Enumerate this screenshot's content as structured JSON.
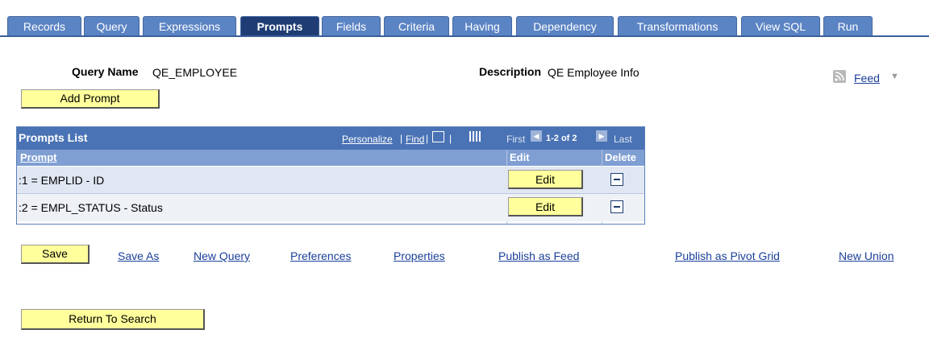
{
  "tabs": [
    {
      "label": "Records"
    },
    {
      "label": "Query"
    },
    {
      "label": "Expressions"
    },
    {
      "label": "Prompts"
    },
    {
      "label": "Fields"
    },
    {
      "label": "Criteria"
    },
    {
      "label": "Having"
    },
    {
      "label": "Dependency"
    },
    {
      "label": "Transformations"
    },
    {
      "label": "View SQL"
    },
    {
      "label": "Run"
    }
  ],
  "header": {
    "query_name_label": "Query Name",
    "query_name_value": "QE_EMPLOYEE",
    "description_label": "Description",
    "description_value": "QE Employee Info",
    "feed_label": "Feed"
  },
  "add_prompt_label": "Add Prompt",
  "grid": {
    "title": "Prompts List",
    "personalize": "Personalize",
    "sep1": "|",
    "find": "Find",
    "sep2": "|",
    "sep3": "|",
    "first": "First",
    "range": "1-2 of 2",
    "last": "Last",
    "columns": {
      "prompt": "Prompt",
      "edit": "Edit",
      "delete": "Delete"
    },
    "rows": [
      {
        "prompt": ":1 = EMPLID - ID",
        "edit": "Edit"
      },
      {
        "prompt": ":2 = EMPL_STATUS - Status",
        "edit": "Edit"
      }
    ]
  },
  "actions": {
    "save": "Save",
    "save_as": "Save As",
    "new_query": "New Query",
    "preferences": "Preferences",
    "properties": "Properties",
    "publish_feed": "Publish as Feed",
    "publish_pivot": "Publish as Pivot Grid",
    "new_union": "New Union"
  },
  "return_label": "Return To Search",
  "colors": {
    "tab": "#5b84c4",
    "tab_active": "#1f3d74",
    "button": "#ffff9c",
    "link": "#1a3f9a",
    "grid_header": "#4a73b5"
  }
}
